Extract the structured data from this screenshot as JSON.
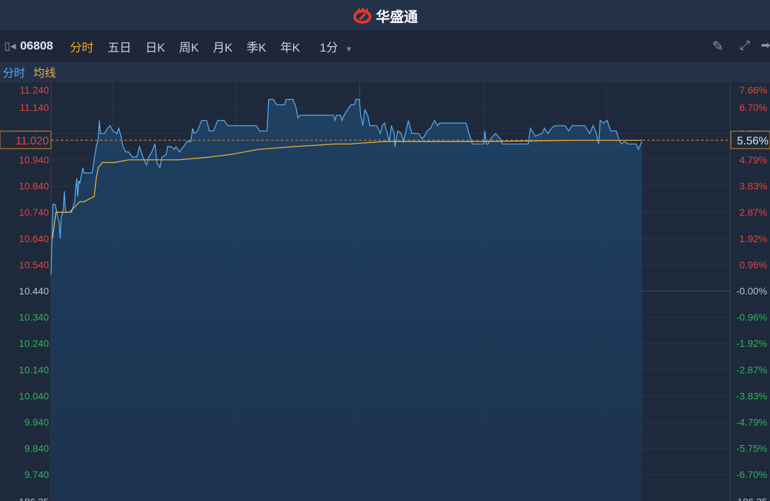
{
  "header": {
    "app_name": "华盛通",
    "brand_color": "#e8352f"
  },
  "toolbar": {
    "code": "06808",
    "tabs": [
      "分时",
      "五日",
      "日K",
      "周K",
      "月K",
      "季K",
      "年K"
    ],
    "active_tab": "分时",
    "interval": "1分"
  },
  "legend": {
    "line": "分时",
    "avg": "均线",
    "line_color": "#5aa9f0",
    "avg_color": "#e8b43c"
  },
  "chart_data": {
    "type": "line",
    "xlabel": "",
    "ylabel": "",
    "x_unit": "minutes since open (9:30, 330-min session)",
    "xlim": [
      0,
      330
    ],
    "ylim": [
      9.69,
      11.24
    ],
    "base_price": 10.44,
    "current_price_label": "11.020",
    "current_pct_label": "5.56%",
    "left_ticks": [
      {
        "v": 11.24,
        "t": "11.240"
      },
      {
        "v": 11.14,
        "t": "11.140"
      },
      {
        "v": 11.04,
        "t": "11.040"
      },
      {
        "v": 10.94,
        "t": "10.940"
      },
      {
        "v": 10.84,
        "t": "10.840"
      },
      {
        "v": 10.74,
        "t": "10.740"
      },
      {
        "v": 10.64,
        "t": "10.640"
      },
      {
        "v": 10.54,
        "t": "10.540"
      },
      {
        "v": 10.44,
        "t": "10.440"
      },
      {
        "v": 10.34,
        "t": "10.340"
      },
      {
        "v": 10.24,
        "t": "10.240"
      },
      {
        "v": 10.14,
        "t": "10.140"
      },
      {
        "v": 10.04,
        "t": "10.040"
      },
      {
        "v": 9.94,
        "t": "9.940"
      },
      {
        "v": 9.84,
        "t": "9.840"
      },
      {
        "v": 9.74,
        "t": "9.740"
      }
    ],
    "right_ticks": [
      "7.66%",
      "6.70%",
      "5.75%",
      "4.79%",
      "3.83%",
      "2.87%",
      "1.92%",
      "0.96%",
      "-0.00%",
      "-0.96%",
      "-1.92%",
      "-2.87%",
      "-3.83%",
      "-4.79%",
      "-5.75%",
      "-6.70%"
    ],
    "bottom_label": "186.35",
    "vgrid_minutes": [
      30,
      90,
      150,
      210,
      270
    ],
    "series": [
      {
        "name": "分时",
        "points": [
          [
            0,
            10.5
          ],
          [
            1,
            10.77
          ],
          [
            2,
            10.77
          ],
          [
            4,
            10.7
          ],
          [
            4.5,
            10.64
          ],
          [
            5,
            10.72
          ],
          [
            6,
            10.75
          ],
          [
            6.5,
            10.82
          ],
          [
            7,
            10.75
          ],
          [
            7.5,
            10.74
          ],
          [
            10,
            10.74
          ],
          [
            11.5,
            10.78
          ],
          [
            12,
            10.83
          ],
          [
            12.5,
            10.87
          ],
          [
            13,
            10.8
          ],
          [
            13.5,
            10.86
          ],
          [
            14,
            10.85
          ],
          [
            15.5,
            10.91
          ],
          [
            16,
            10.89
          ],
          [
            20,
            10.89
          ],
          [
            21,
            10.94
          ],
          [
            22,
            10.99
          ],
          [
            23,
            11.02
          ],
          [
            23.5,
            11.09
          ],
          [
            24,
            11.04
          ],
          [
            26,
            11.04
          ],
          [
            27.5,
            11.06
          ],
          [
            28.8,
            11.07
          ],
          [
            30,
            11.05
          ],
          [
            32,
            11.04
          ],
          [
            33,
            11.06
          ],
          [
            34,
            11.03
          ],
          [
            35,
            10.99
          ],
          [
            36.3,
            10.97
          ],
          [
            37.6,
            10.97
          ],
          [
            39.6,
            10.95
          ],
          [
            41.7,
            10.95
          ],
          [
            43,
            10.99
          ],
          [
            44.7,
            10.95
          ],
          [
            46.4,
            10.92
          ],
          [
            47.5,
            10.95
          ],
          [
            49,
            10.97
          ],
          [
            50.5,
            11.0
          ],
          [
            51.5,
            10.93
          ],
          [
            52.9,
            10.91
          ],
          [
            53.9,
            10.95
          ],
          [
            56,
            10.96
          ],
          [
            56.6,
            10.99
          ],
          [
            58.3,
            10.99
          ],
          [
            60,
            10.98
          ],
          [
            60.7,
            10.99
          ],
          [
            62.4,
            10.97
          ],
          [
            64.4,
            10.99
          ],
          [
            66.1,
            11.01
          ],
          [
            68,
            11.01
          ],
          [
            68.8,
            11.06
          ],
          [
            69.5,
            11.04
          ],
          [
            71.2,
            11.05
          ],
          [
            73.2,
            11.09
          ],
          [
            75.6,
            11.09
          ],
          [
            77,
            11.05
          ],
          [
            79,
            11.05
          ],
          [
            81,
            11.09
          ],
          [
            84,
            11.09
          ],
          [
            86,
            11.07
          ],
          [
            99.7,
            11.07
          ],
          [
            101.4,
            11.05
          ],
          [
            105,
            11.05
          ],
          [
            105.8,
            11.17
          ],
          [
            108.1,
            11.17
          ],
          [
            109.5,
            11.15
          ],
          [
            113.6,
            11.15
          ],
          [
            114.2,
            11.17
          ],
          [
            117.6,
            11.17
          ],
          [
            119,
            11.14
          ],
          [
            120,
            11.1
          ],
          [
            121,
            11.11
          ],
          [
            137.3,
            11.11
          ],
          [
            138,
            11.09
          ],
          [
            138.7,
            11.11
          ],
          [
            140.7,
            11.11
          ],
          [
            141.4,
            11.09
          ],
          [
            142.4,
            11.11
          ],
          [
            144,
            11.13
          ],
          [
            145.8,
            11.15
          ],
          [
            147.5,
            11.15
          ],
          [
            148.1,
            11.17
          ],
          [
            149.8,
            11.17
          ],
          [
            150.5,
            11.11
          ],
          [
            151.5,
            11.07
          ],
          [
            152.5,
            11.13
          ],
          [
            153.9,
            11.11
          ],
          [
            154.9,
            11.07
          ],
          [
            158.3,
            11.07
          ],
          [
            160,
            11.04
          ],
          [
            161,
            11.07
          ],
          [
            162.1,
            11.08
          ],
          [
            163.4,
            11.04
          ],
          [
            164.4,
            11.01
          ],
          [
            165.4,
            11.07
          ],
          [
            166.8,
            11.04
          ],
          [
            167.1,
            10.99
          ],
          [
            168.5,
            11.05
          ],
          [
            170.2,
            11.04
          ],
          [
            171.2,
            11.01
          ],
          [
            172.5,
            11.05
          ],
          [
            173.6,
            11.09
          ],
          [
            175.3,
            11.04
          ],
          [
            178.6,
            11.04
          ],
          [
            180.3,
            11.02
          ],
          [
            181.4,
            11.03
          ],
          [
            182.7,
            11.05
          ],
          [
            184.4,
            11.06
          ],
          [
            186.4,
            11.09
          ],
          [
            187.8,
            11.07
          ],
          [
            188.8,
            11.08
          ],
          [
            201.7,
            11.08
          ],
          [
            203.1,
            11.04
          ],
          [
            204.7,
            11.0
          ],
          [
            210.2,
            11.0
          ],
          [
            210.8,
            11.05
          ],
          [
            211.5,
            11.0
          ],
          [
            212.5,
            11.0
          ],
          [
            213.6,
            11.02
          ],
          [
            216,
            11.04
          ],
          [
            218.3,
            11.02
          ],
          [
            219.3,
            11.0
          ],
          [
            231.9,
            11.0
          ],
          [
            232.9,
            11.06
          ],
          [
            235.3,
            11.03
          ],
          [
            238.6,
            11.04
          ],
          [
            239.7,
            11.06
          ],
          [
            241.4,
            11.04
          ],
          [
            243.1,
            11.06
          ],
          [
            244.7,
            11.07
          ],
          [
            249.8,
            11.07
          ],
          [
            251.5,
            11.05
          ],
          [
            253.2,
            11.07
          ],
          [
            259.3,
            11.07
          ],
          [
            261,
            11.05
          ],
          [
            261.7,
            11.04
          ],
          [
            263.4,
            11.07
          ],
          [
            265,
            11.04
          ],
          [
            265.8,
            11.01
          ],
          [
            266.1,
            11.0
          ],
          [
            266.8,
            11.09
          ],
          [
            268.5,
            11.08
          ],
          [
            270.2,
            11.09
          ],
          [
            271.9,
            11.05
          ],
          [
            274.6,
            11.05
          ],
          [
            276.3,
            11.01
          ],
          [
            277.3,
            11.0
          ],
          [
            278.6,
            11.01
          ],
          [
            280.3,
            11.0
          ],
          [
            284.4,
            11.0
          ],
          [
            285.4,
            10.98
          ],
          [
            287.1,
            11.01
          ]
        ]
      },
      {
        "name": "均线",
        "points": [
          [
            0.7,
            10.64
          ],
          [
            2.4,
            10.74
          ],
          [
            4,
            10.74
          ],
          [
            9,
            10.74
          ],
          [
            11.5,
            10.76
          ],
          [
            14,
            10.78
          ],
          [
            16,
            10.78
          ],
          [
            21,
            10.8
          ],
          [
            22,
            10.87
          ],
          [
            23,
            10.91
          ],
          [
            25,
            10.93
          ],
          [
            31,
            10.93
          ],
          [
            38,
            10.94
          ],
          [
            50,
            10.94
          ],
          [
            62,
            10.94
          ],
          [
            77,
            10.95
          ],
          [
            87,
            10.96
          ],
          [
            101,
            10.98
          ],
          [
            118,
            10.99
          ],
          [
            138,
            11.0
          ],
          [
            145,
            11.0
          ],
          [
            162,
            11.01
          ],
          [
            179,
            11.01
          ],
          [
            213,
            11.01
          ],
          [
            255,
            11.014
          ],
          [
            287,
            11.014
          ]
        ]
      }
    ]
  }
}
